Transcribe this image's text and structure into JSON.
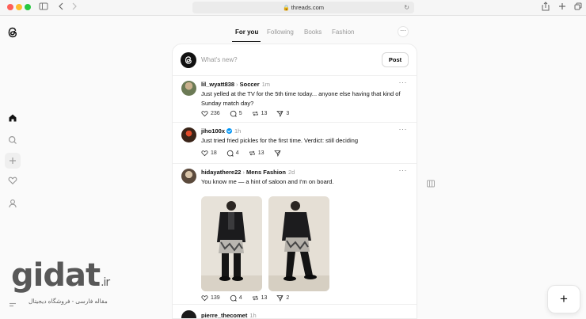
{
  "browser": {
    "url": "threads.com"
  },
  "tabs": [
    {
      "label": "For you",
      "active": true
    },
    {
      "label": "Following",
      "active": false
    },
    {
      "label": "Books",
      "active": false
    },
    {
      "label": "Fashion",
      "active": false
    }
  ],
  "composer": {
    "placeholder": "What's new?",
    "post_label": "Post"
  },
  "posts": [
    {
      "username": "lil_wyatt838",
      "topic": "Soccer",
      "time": "1m",
      "text": "Just yelled at the TV for the 5th time today... anyone else having that kind of Sunday match day?",
      "likes": "236",
      "replies": "5",
      "reposts": "13",
      "shares": "3"
    },
    {
      "username": "jiho100x",
      "verified": true,
      "time": "1h",
      "text": "Just tried fried pickles for the first time. Verdict: still deciding",
      "likes": "18",
      "replies": "4",
      "reposts": "13",
      "shares": ""
    },
    {
      "username": "hidayathere22",
      "topic": "Mens Fashion",
      "time": "2d",
      "text": "You know me — a hint of saloon and I'm on board.",
      "likes": "139",
      "replies": "4",
      "reposts": "13",
      "shares": "2"
    },
    {
      "username": "pierre_thecomet",
      "time": "1h"
    }
  ],
  "watermark": {
    "logo": "gidat",
    "tld": ".ir",
    "subtitle": "مقاله فارسی - فروشگاه دیجیتال"
  },
  "colors": {
    "accent_verified": "#0095f6",
    "background": "#fafafa"
  },
  "icons": [
    "threads-logo-icon",
    "home-icon",
    "search-icon",
    "create-icon",
    "heart-icon",
    "profile-icon",
    "menu-icon",
    "sidebar-toggle-icon",
    "back-icon",
    "forward-icon",
    "share-icon",
    "new-tab-icon",
    "tabs-icon",
    "lock-icon",
    "reload-icon",
    "more-icon",
    "comment-icon",
    "repost-icon",
    "send-icon",
    "column-icon",
    "plus-icon"
  ]
}
